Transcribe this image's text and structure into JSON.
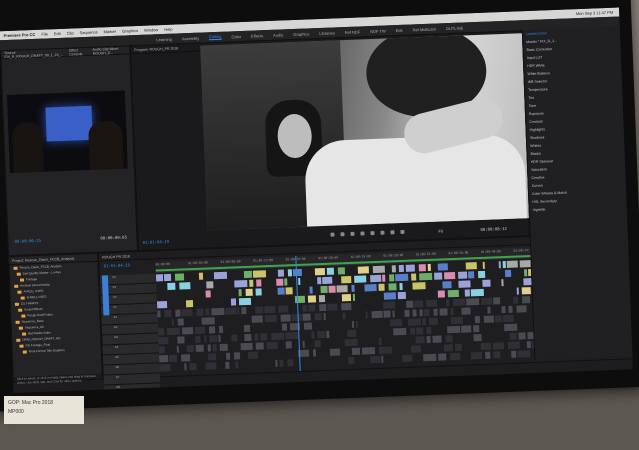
{
  "menubar": {
    "app": "Premiere Pro CC",
    "items": [
      "File",
      "Edit",
      "Clip",
      "Sequence",
      "Marker",
      "Graphics",
      "Window",
      "Help"
    ],
    "clock": "Mon Sep 3  11:47 PM"
  },
  "workspaces": {
    "items": [
      "Learning",
      "Assembly",
      "Editing",
      "Color",
      "Effects",
      "Audio",
      "Graphics",
      "Libraries",
      "Ref NDF",
      "NDF TW",
      "Edit",
      "Ref Multicam",
      "OUTLINE"
    ],
    "active": "Editing"
  },
  "source_panel": {
    "tabs": [
      "Source: FIX_R_ROUGH_DRAFT_09_1_23_...",
      "Effect Controls",
      "Audio Clip Mixer: ROUGH_D...",
      "Metadata"
    ],
    "timecode_in": "00:00:06:15",
    "timecode_out": "00:00:00:05"
  },
  "program_panel": {
    "tab": "Program: ROUGH_PR 2018",
    "timecode": "01:01:04:19",
    "fit": "Fit",
    "duration": "00:00:08:12"
  },
  "project_panel": {
    "tabs": [
      "Project: Rescue_Dawn_FCCB_Analysis"
    ],
    "items": [
      "Rescue_Dawn_FCCB_Analysis",
      "Dart Quality Master - Lo-Res",
      "Footage",
      "Archival Stored Media",
      "A-ROLL USED",
      "B-ROLL USED",
      "CUT-AWAYS",
      "Sound Effects",
      "Rough Draft Folder",
      "Sequence_Base",
      "Sequence_Alt",
      "Bad Media Video",
      "ORIG_ROUGH_DRAFT_HD",
      "DG Footage_Final",
      "Final Format Title Graphics"
    ],
    "footer": "Click to select, or click in empty space and drag to marquee select. Use Shift, Opt, and Cmd for other options."
  },
  "timeline": {
    "tab": "ROUGH PR 2018",
    "timecode": "01:01:04:19",
    "ruler_labels": [
      "00:00:00",
      "01:00:04:00",
      "01:00:08:00",
      "01:00:12:00",
      "01:00:16:00",
      "01:00:20:00",
      "01:00:24:00",
      "01:00:28:00",
      "01:00:32:00",
      "01:00:36:00",
      "01:00:40:00",
      "01:00:44:00",
      "01:00:48:00",
      "01:00:52:00"
    ],
    "track_labels": [
      "V4",
      "V3",
      "V2",
      "V1",
      "A1",
      "A2",
      "A3",
      "A4",
      "A5",
      "A6",
      "A7",
      "A8"
    ]
  },
  "lumetri": {
    "title": "Lumetri Color",
    "master": "Master * FIX_R_1...",
    "rows": [
      "Basic Correction",
      "Input LUT",
      "HDR White",
      "White Balance",
      "WB Selector",
      "Temperature",
      "Tint",
      "Tone",
      "Exposure",
      "Contrast",
      "Highlights",
      "Shadows",
      "Whites",
      "Blacks",
      "HDR Specular",
      "Saturation",
      "Creative",
      "Curves",
      "Color Wheels & Match",
      "HSL Secondary",
      "Vignette"
    ]
  },
  "wall_label": {
    "line1": "GOP: Mac Pro 2018",
    "line2": "MP000"
  }
}
